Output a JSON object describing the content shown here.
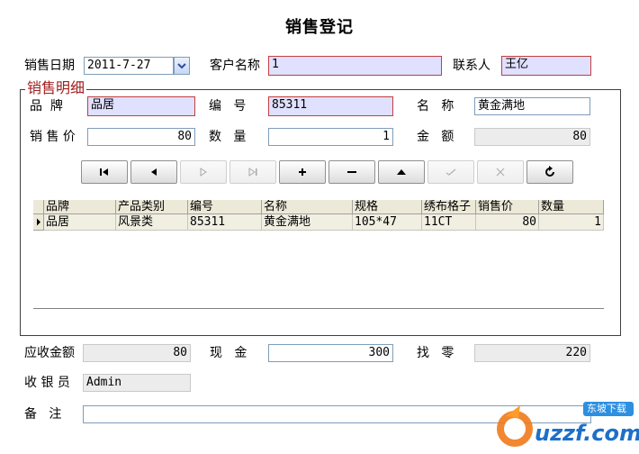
{
  "window": {
    "title": "销售登记"
  },
  "header": {
    "sale_date_label": "销售日期",
    "sale_date_value": "2011-7-27",
    "customer_label": "客户名称",
    "customer_value": "1",
    "contact_label": "联系人",
    "contact_value": "王亿"
  },
  "detail": {
    "group_title": "销售明细",
    "brand_label": "品  牌",
    "brand_value": "品居",
    "code_label": "编   号",
    "code_value": "85311",
    "name_label": "名   称",
    "name_value": "黄金满地",
    "price_label": "销 售 价",
    "price_value": "80",
    "qty_label": "数   量",
    "qty_value": "1",
    "amount_label": "金   额",
    "amount_value": "80"
  },
  "navigator": {
    "buttons": [
      {
        "name": "first",
        "glyph": "I◀",
        "enabled": true
      },
      {
        "name": "prior",
        "glyph": "◀",
        "enabled": true
      },
      {
        "name": "next",
        "glyph": "▷",
        "enabled": false
      },
      {
        "name": "last",
        "glyph": "▷I",
        "enabled": false
      },
      {
        "name": "insert",
        "glyph": "+",
        "enabled": true
      },
      {
        "name": "delete",
        "glyph": "−",
        "enabled": true
      },
      {
        "name": "edit",
        "glyph": "▲",
        "enabled": true
      },
      {
        "name": "post",
        "glyph": "✓",
        "enabled": false
      },
      {
        "name": "cancel",
        "glyph": "✕",
        "enabled": false
      },
      {
        "name": "refresh",
        "glyph": "↻",
        "enabled": true
      }
    ]
  },
  "grid": {
    "columns": [
      "品牌",
      "产品类别",
      "编号",
      "名称",
      "规格",
      "绣布格子",
      "销售价",
      "数量"
    ],
    "rows": [
      [
        "品居",
        "风景类",
        "85311",
        "黄金满地",
        "105*47",
        "11CT",
        "80",
        "1"
      ]
    ]
  },
  "footer": {
    "receivable_label": "应收金额",
    "receivable_value": "80",
    "cash_label": "现   金",
    "cash_value": "300",
    "change_label": "找   零",
    "change_value": "220",
    "cashier_label": "收 银 员",
    "cashier_value": "Admin",
    "remark_label": "备   注",
    "remark_value": ""
  },
  "watermark": {
    "text": "uzzf.com",
    "badge": "东坡下载"
  },
  "colors": {
    "required_bg": "#e0e0ff",
    "required_border": "#c04040",
    "group_title": "#a02020",
    "readonly_bg": "#ececec"
  }
}
